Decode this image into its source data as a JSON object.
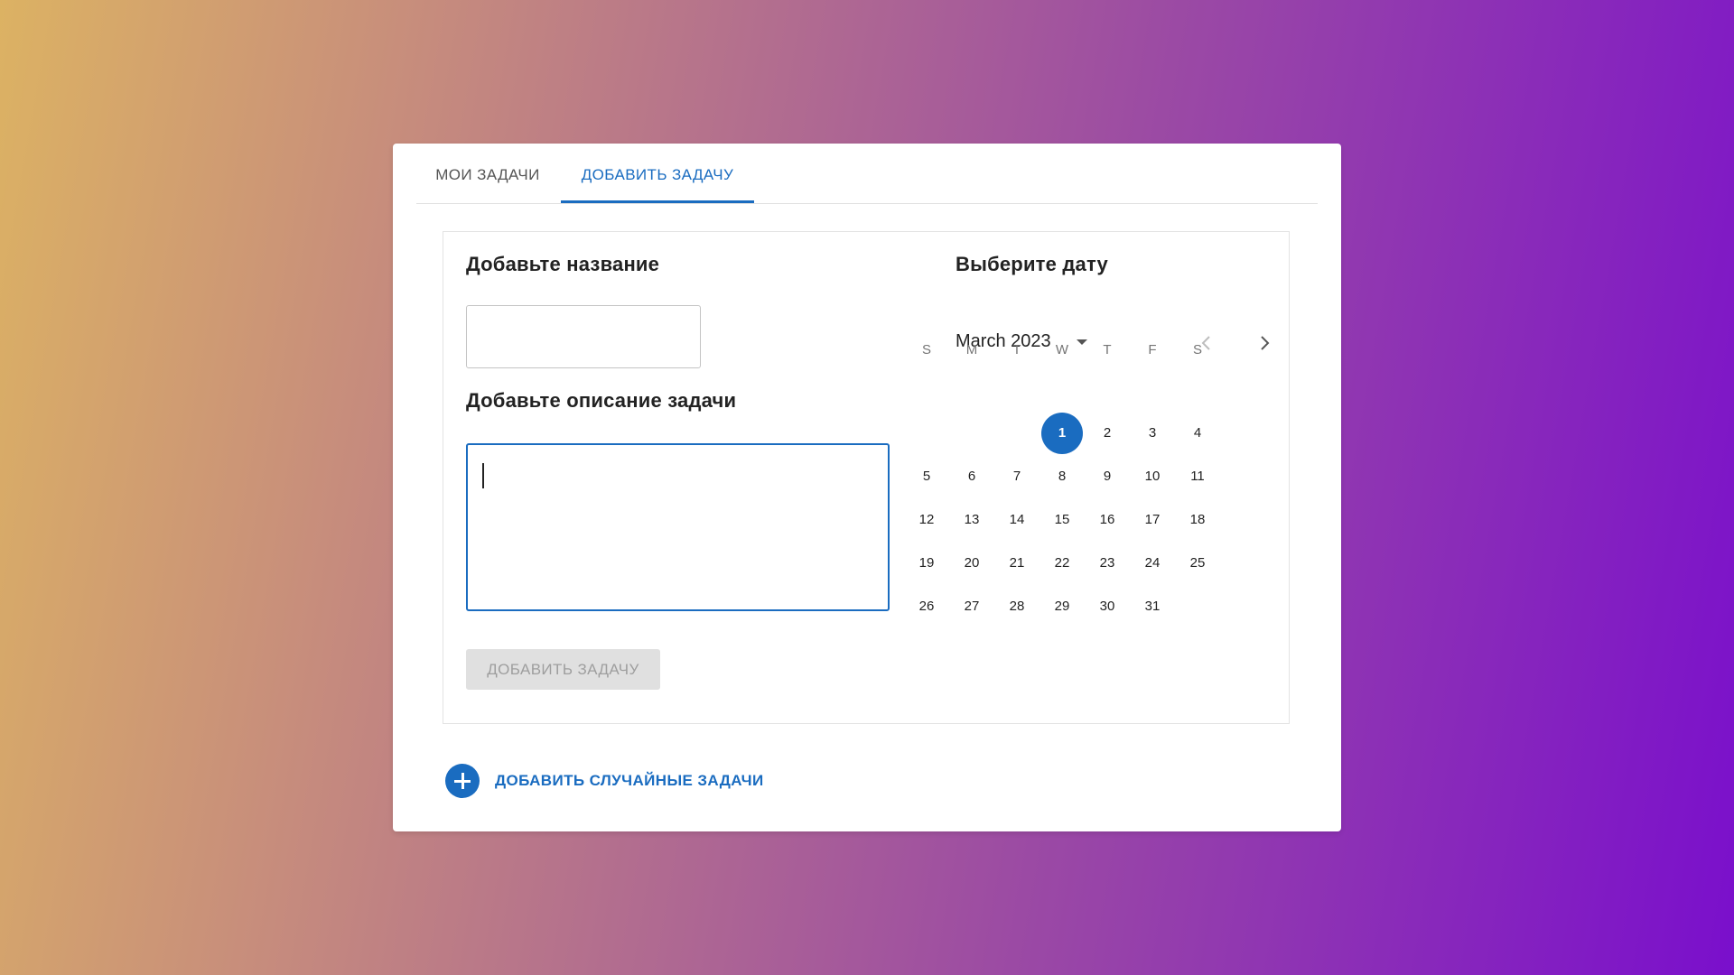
{
  "tabs": [
    {
      "label": "МОИ ЗАДАЧИ",
      "active": false
    },
    {
      "label": "ДОБАВИТЬ ЗАДАЧУ",
      "active": true
    }
  ],
  "form": {
    "title_label": "Добавьте название",
    "title_value": "",
    "description_label": "Добавьте описание задачи",
    "description_value": "",
    "submit_label": "ДОБАВИТЬ ЗАДАЧУ",
    "submit_disabled": true
  },
  "calendar": {
    "label": "Выберите дату",
    "month_label": "March 2023",
    "weekday_headers": [
      "S",
      "M",
      "T",
      "W",
      "T",
      "F",
      "S"
    ],
    "first_weekday_index": 3,
    "days_in_month": 31,
    "selected_day": 1,
    "days": [
      "1",
      "2",
      "3",
      "4",
      "5",
      "6",
      "7",
      "8",
      "9",
      "10",
      "11",
      "12",
      "13",
      "14",
      "15",
      "16",
      "17",
      "18",
      "19",
      "20",
      "21",
      "22",
      "23",
      "24",
      "25",
      "26",
      "27",
      "28",
      "29",
      "30",
      "31"
    ]
  },
  "random_tasks": {
    "label": "ДОБАВИТЬ СЛУЧАЙНЫЕ ЗАДАЧИ"
  },
  "colors": {
    "accent": "#1a6cc0",
    "disabled_bg": "#e0e0e0",
    "disabled_text": "#9e9e9e"
  },
  "icons": {
    "month_dropdown": "caret-down-icon",
    "prev": "chevron-left-icon",
    "next": "chevron-right-icon",
    "add": "plus-circle-icon"
  }
}
